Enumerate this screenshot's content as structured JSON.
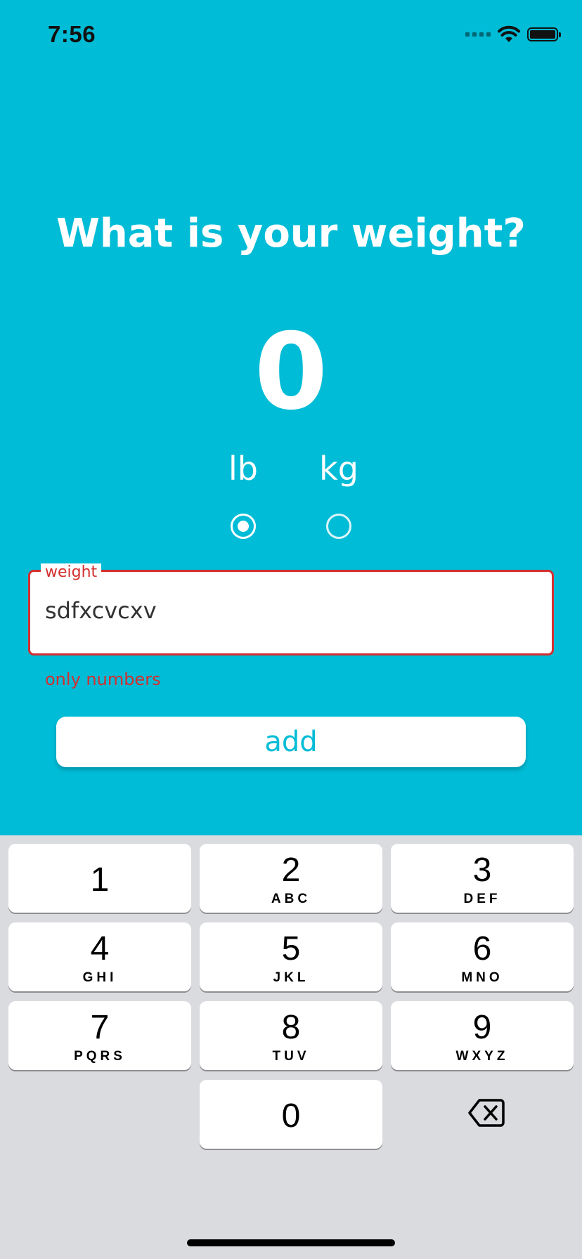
{
  "status_bar": {
    "time": "7:56"
  },
  "screen": {
    "title": "What is your weight?",
    "weight_value": "0",
    "units": [
      {
        "label": "lb",
        "selected": true
      },
      {
        "label": "kg",
        "selected": false
      }
    ]
  },
  "weight_field": {
    "label": "weight",
    "value": "sdfxcvcxv",
    "error": "only numbers"
  },
  "add_button": {
    "label": "add"
  },
  "keyboard": {
    "keys": [
      {
        "num": "1",
        "letters": ""
      },
      {
        "num": "2",
        "letters": "ABC"
      },
      {
        "num": "3",
        "letters": "DEF"
      },
      {
        "num": "4",
        "letters": "GHI"
      },
      {
        "num": "5",
        "letters": "JKL"
      },
      {
        "num": "6",
        "letters": "MNO"
      },
      {
        "num": "7",
        "letters": "PQRS"
      },
      {
        "num": "8",
        "letters": "TUV"
      },
      {
        "num": "9",
        "letters": "WXYZ"
      },
      {
        "num": "0",
        "letters": ""
      }
    ],
    "backspace_icon": "backspace-icon"
  },
  "colors": {
    "primary": "#00bcd6",
    "error": "#d32f2f",
    "keyboard_bg": "#dadbdf"
  }
}
